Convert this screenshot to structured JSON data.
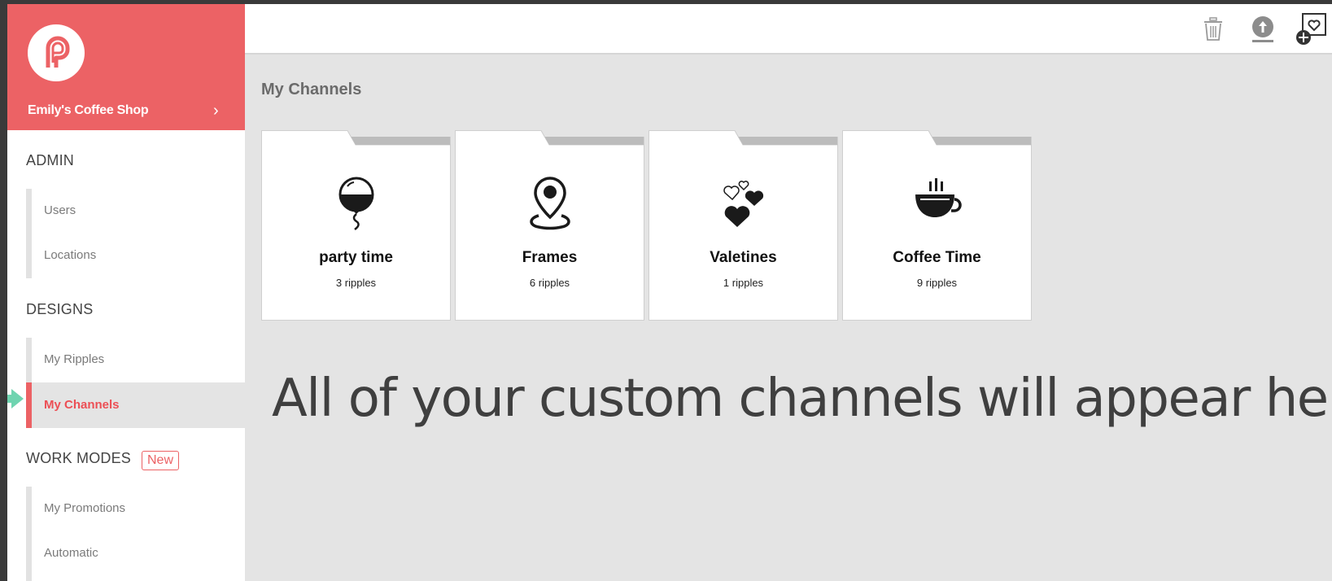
{
  "sidebar": {
    "brand_name": "Emily's Coffee Shop",
    "sections": {
      "admin": "ADMIN",
      "designs": "DESIGNS",
      "work_modes": "WORK MODES",
      "new_badge": "New"
    },
    "items": {
      "users": "Users",
      "locations": "Locations",
      "my_ripples": "My Ripples",
      "my_channels": "My Channels",
      "my_promotions": "My Promotions",
      "automatic": "Automatic"
    },
    "active_item": "My Channels"
  },
  "topbar": {
    "icons": [
      "trash-icon",
      "upload-icon",
      "add-channel-icon"
    ]
  },
  "main": {
    "title": "My Channels",
    "channels": [
      {
        "name": "party time",
        "count": "3 ripples",
        "icon": "balloon-icon"
      },
      {
        "name": "Frames",
        "count": "6 ripples",
        "icon": "location-pin-icon"
      },
      {
        "name": "Valetines",
        "count": "1 ripples",
        "icon": "hearts-icon"
      },
      {
        "name": "Coffee Time",
        "count": "9 ripples",
        "icon": "coffee-cup-icon"
      }
    ],
    "hint": "All of your custom channels will appear here."
  },
  "colors": {
    "brand": "#ec6265",
    "background": "#e4e4e4",
    "pointer": "#6fd4b0"
  }
}
